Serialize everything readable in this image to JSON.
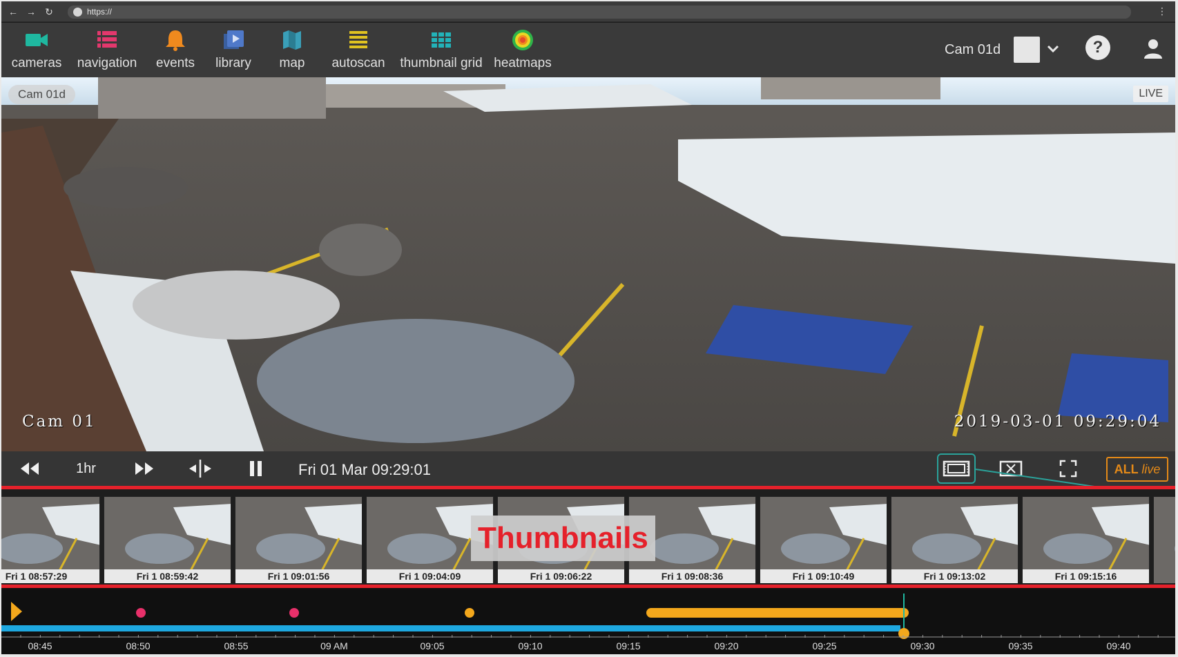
{
  "browser": {
    "url": "https://",
    "back_icon": "back-arrow-icon",
    "forward_icon": "forward-arrow-icon",
    "reload_icon": "reload-icon",
    "menu_icon": "menu-dots-icon"
  },
  "nav": {
    "items": [
      {
        "label": "cameras",
        "icon": "video-camera-icon",
        "color": "#1fb8a0"
      },
      {
        "label": "navigation",
        "icon": "list-icon",
        "color": "#e3386d"
      },
      {
        "label": "events",
        "icon": "bell-icon",
        "color": "#f08a1e"
      },
      {
        "label": "library",
        "icon": "video-library-icon",
        "color": "#4f79c9"
      },
      {
        "label": "map",
        "icon": "map-icon",
        "color": "#3a9fb8"
      },
      {
        "label": "autoscan",
        "icon": "autoscan-icon",
        "color": "#e0c321"
      },
      {
        "label": "thumbnail grid",
        "icon": "grid-icon",
        "color": "#22b3b9"
      },
      {
        "label": "heatmaps",
        "icon": "heatmap-icon",
        "color": "#e24a2a"
      }
    ],
    "camera_label": "Cam 01d",
    "swatch_color": "#e6e6e6"
  },
  "video": {
    "camera_chip": "Cam 01d",
    "live_badge": "LIVE",
    "osd_camera": "Cam 01",
    "osd_timestamp": "2019-03-01 09:29:04"
  },
  "controls": {
    "range": "1hr",
    "datetime": "Fri 01 Mar 09:29:01",
    "all_label": "ALL",
    "live_label": "live",
    "accent": "#2aa39b",
    "live_color": "#e58a18"
  },
  "thumbnails": {
    "annotation": "Thumbnails",
    "items": [
      "Fri 1 08:57:29",
      "Fri 1 08:59:42",
      "Fri 1 09:01:56",
      "Fri 1 09:04:09",
      "Fri 1 09:06:22",
      "Fri 1 09:08:36",
      "Fri 1 09:10:49",
      "Fri 1 09:13:02",
      "Fri 1 09:15:16"
    ]
  },
  "timeline": {
    "ticks": [
      "08:45",
      "08:50",
      "08:55",
      "09 AM",
      "09:05",
      "09:10",
      "09:15",
      "09:20",
      "09:25",
      "09:30",
      "09:35",
      "09:40"
    ],
    "recording_color": "#1ea8e0",
    "motion_color": "#f4a81c",
    "event_color": "#e8306a"
  }
}
